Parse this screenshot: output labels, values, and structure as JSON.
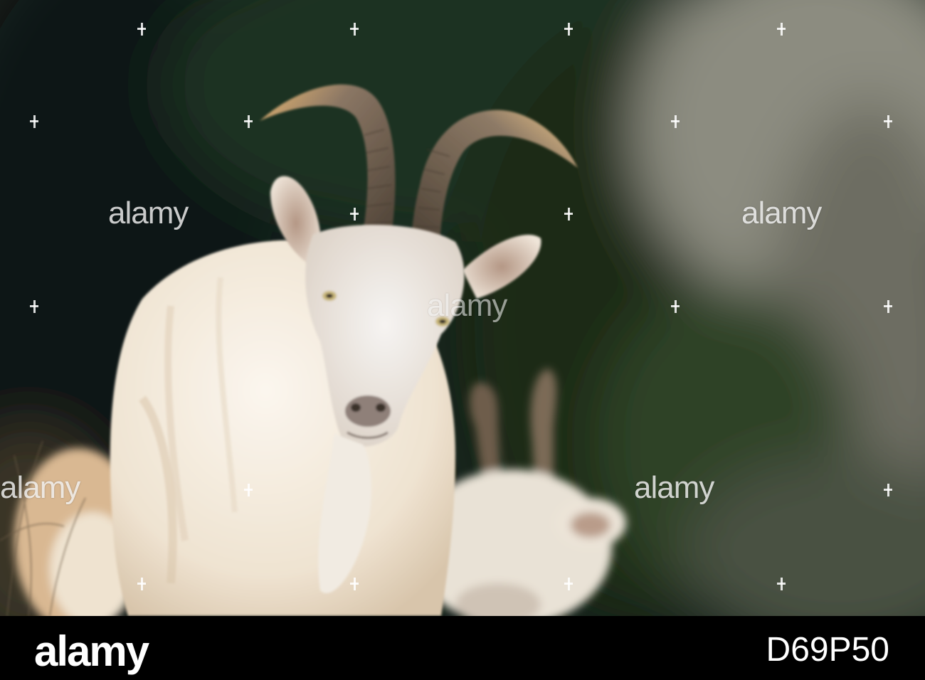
{
  "photo": {
    "subject": "white-goat-with-horns",
    "background_color": "#1d2a1c"
  },
  "watermark": {
    "text": "alamy"
  },
  "footer": {
    "logo": "alamy",
    "image_id": "D69P50"
  }
}
